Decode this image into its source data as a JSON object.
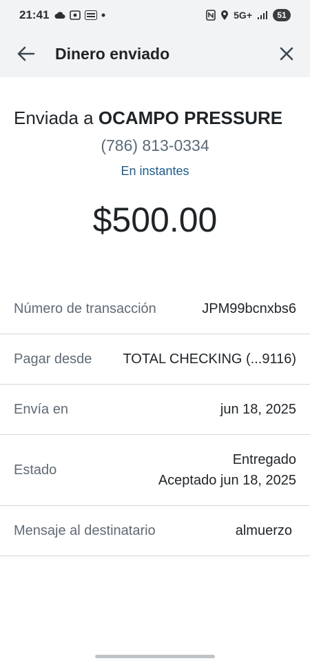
{
  "status_bar": {
    "time": "21:41",
    "left_icons": [
      "cloud-icon",
      "screen-record-icon",
      "temu-app-icon",
      "dot-icon"
    ],
    "network": "5G+",
    "battery": "51"
  },
  "header": {
    "title": "Dinero enviado"
  },
  "summary": {
    "sent_prefix": "Enviada a ",
    "recipient_name": "OCAMPO PRESSURE",
    "phone": "(786) 813-0334",
    "speed": "En instantes",
    "amount": "$500.00"
  },
  "details": {
    "transaction": {
      "label": "Número de transacción",
      "value": "JPM99bcnxbs6"
    },
    "pay_from": {
      "label": "Pagar desde",
      "value": "TOTAL CHECKING (...9116)"
    },
    "send_on": {
      "label": "Envía en",
      "value": "jun 18, 2025"
    },
    "status": {
      "label": "Estado",
      "value_line1": "Entregado",
      "value_line2": "Aceptado jun 18, 2025"
    },
    "message": {
      "label": "Mensaje al destinatario",
      "value": "almuerzo"
    }
  },
  "colors": {
    "header_bg": "#f2f3f5",
    "link_blue": "#1e5b8a",
    "phone_gray": "#5a6a78",
    "divider": "#d3d6da"
  }
}
